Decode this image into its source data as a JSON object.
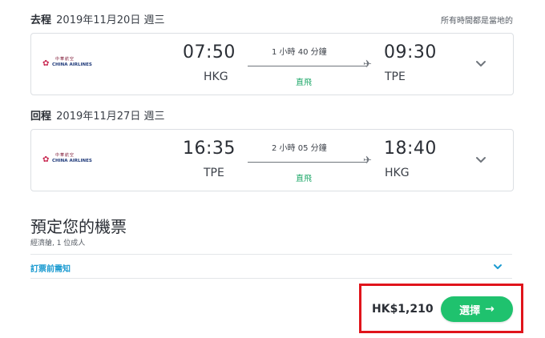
{
  "outbound": {
    "direction": "去程",
    "date": "2019年11月20日 週三",
    "timezone_note": "所有時間都是當地的",
    "airline": {
      "name_cn": "中華航空",
      "name_en": "CHINA AIRLINES"
    },
    "depart_time": "07:50",
    "depart_code": "HKG",
    "duration": "1 小時 40 分鐘",
    "stops": "直飛",
    "arrive_time": "09:30",
    "arrive_code": "TPE"
  },
  "return": {
    "direction": "回程",
    "date": "2019年11月27日 週三",
    "airline": {
      "name_cn": "中華航空",
      "name_en": "CHINA AIRLINES"
    },
    "depart_time": "16:35",
    "depart_code": "TPE",
    "duration": "2 小時 05 分鐘",
    "stops": "直飛",
    "arrive_time": "18:40",
    "arrive_code": "HKG"
  },
  "booking": {
    "title": "預定您的機票",
    "subtitle": "經濟艙, 1 位成人",
    "terms_link": "訂票前需知",
    "price": "HK$1,210",
    "select_label": "選擇",
    "select_icon": "→"
  },
  "colors": {
    "accent_green": "#1fc26e",
    "link_blue": "#1c9bd1",
    "highlight_red": "#e0141b"
  }
}
